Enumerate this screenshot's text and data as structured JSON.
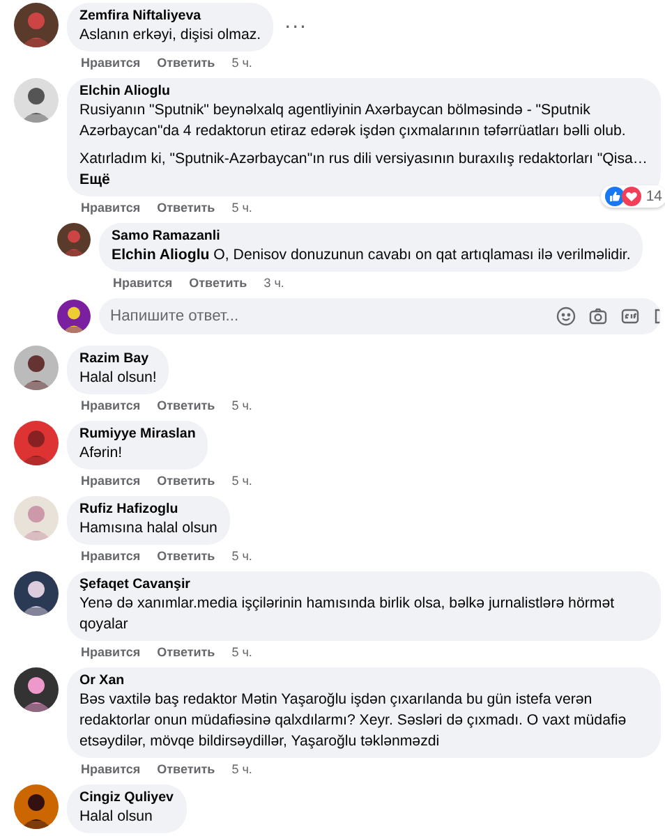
{
  "comments": [
    {
      "author": "Zemfira Niftaliyeva",
      "paragraphs": [
        "Aslanın erkəyi, dişisi olmaz."
      ],
      "menu": "...",
      "actions": {
        "like": "Нравится",
        "reply": "Ответить",
        "time": "5 ч."
      }
    },
    {
      "author": "Elchin Alioglu",
      "paragraphs": [
        "Rusiyanın \"Sputnik\" beynəlxalq agentliyinin Axərbaycan bölməsində - \"Sputnik Azərbaycan\"da 4 redaktorun etiraz edərək işdən çıxmalarının təfərrüatları bəlli olub.",
        "Xatırladım ki, \"Sputnik-Azərbaycan\"ın rus dili versiyasının buraxılış redaktorları \"Qisa…"
      ],
      "more": "Ещё",
      "reactions": {
        "count": "14"
      },
      "actions": {
        "like": "Нравится",
        "reply": "Ответить",
        "time": "5 ч."
      },
      "replies": [
        {
          "author": "Samo Ramazanli",
          "paragraphs": [
            "**Elchin Alioglu** O, Denisov donuzunun cavabı on qat artıqlaması ilə verilməlidir."
          ],
          "actions": {
            "like": "Нравится",
            "reply": "Ответить",
            "time": "3 ч."
          }
        }
      ],
      "reply_box": {
        "placeholder": "Напишите ответ..."
      }
    },
    {
      "author": "Razim Bay",
      "paragraphs": [
        "Halal olsun!"
      ],
      "actions": {
        "like": "Нравится",
        "reply": "Ответить",
        "time": "5 ч."
      }
    },
    {
      "author": "Rumiyye Miraslan",
      "paragraphs": [
        "Afərin!"
      ],
      "actions": {
        "like": "Нравится",
        "reply": "Ответить",
        "time": "5 ч."
      }
    },
    {
      "author": "Rufiz Hafizoglu",
      "paragraphs": [
        "Hamısına halal olsun"
      ],
      "actions": {
        "like": "Нравится",
        "reply": "Ответить",
        "time": "5 ч."
      }
    },
    {
      "author": "Şefaqet Cavanşir",
      "paragraphs": [
        "Yenə də xanımlar.media işçilərinin hamısında birlik olsa, bəlkə jurnalistlərə hörmət qoyalar"
      ],
      "actions": {
        "like": "Нравится",
        "reply": "Ответить",
        "time": "5 ч."
      }
    },
    {
      "author": "Or Xan",
      "paragraphs": [
        "Bəs vaxtilə baş redaktor Mətin Yaşaroğlu işdən çıxarılanda bu gün istefa verən redaktorlar onun müdafiəsinə qalxdılarmı? Xeyr. Səsləri də çıxmadı. O vaxt müdafiə etsəydilər, mövqe bildirsəydillər, Yaşaroğlu təklənməzdi"
      ],
      "actions": {
        "like": "Нравится",
        "reply": "Ответить",
        "time": "5 ч."
      }
    },
    {
      "author": "Cingiz Quliyev",
      "paragraphs": [
        "Halal olsun"
      ]
    }
  ]
}
